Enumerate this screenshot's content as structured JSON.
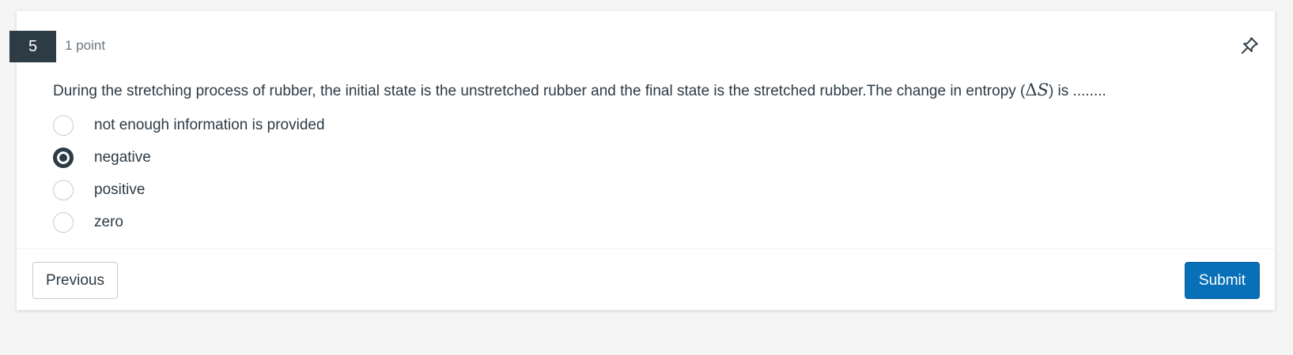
{
  "question": {
    "number": "5",
    "points": "1 point",
    "text_before": "During the stretching process of rubber, the initial state is the unstretched rubber and the final state is the stretched rubber.The change in entropy (",
    "math_delta": "Δ",
    "math_var": "S",
    "text_after": ") is ........",
    "answers": [
      {
        "label": "not enough information is provided",
        "selected": false
      },
      {
        "label": "negative",
        "selected": true
      },
      {
        "label": "positive",
        "selected": false
      },
      {
        "label": "zero",
        "selected": false
      }
    ]
  },
  "icons": {
    "pin": "pin-icon"
  },
  "buttons": {
    "previous": "Previous",
    "submit": "Submit"
  },
  "colors": {
    "primary": "#0770b8",
    "dark": "#2d3b45"
  }
}
